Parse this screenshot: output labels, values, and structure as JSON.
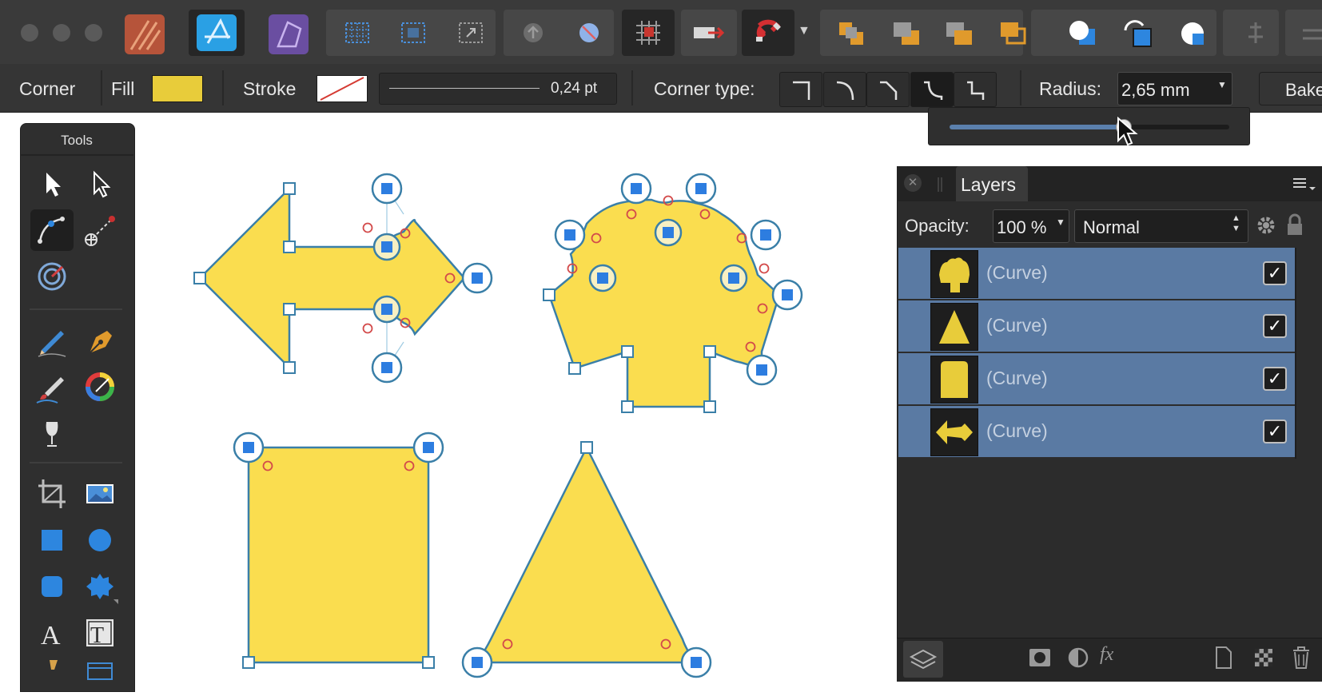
{
  "context_bar": {
    "corner_label": "Corner",
    "fill_label": "Fill",
    "fill_color": "#e8cc3a",
    "stroke_label": "Stroke",
    "stroke_width": "0,24 pt",
    "corner_type_label": "Corner type:",
    "radius_label": "Radius:",
    "radius_value": "2,65 mm",
    "bake_label": "Bake",
    "radius_slider_fraction": 0.62
  },
  "tools": {
    "title": "Tools"
  },
  "layers": {
    "tab_label": "Layers",
    "opacity_label": "Opacity:",
    "opacity_value": "100 %",
    "blend_mode": "Normal",
    "items": [
      {
        "name": "(Curve)",
        "visible": true
      },
      {
        "name": "(Curve)",
        "visible": true
      },
      {
        "name": "(Curve)",
        "visible": true
      },
      {
        "name": "(Curve)",
        "visible": true
      }
    ]
  },
  "colors": {
    "shape_fill": "#fadd4f",
    "shape_stroke": "#3a7fa8",
    "selection_blue": "#2d7de0",
    "layer_row": "#5a7aa3"
  }
}
